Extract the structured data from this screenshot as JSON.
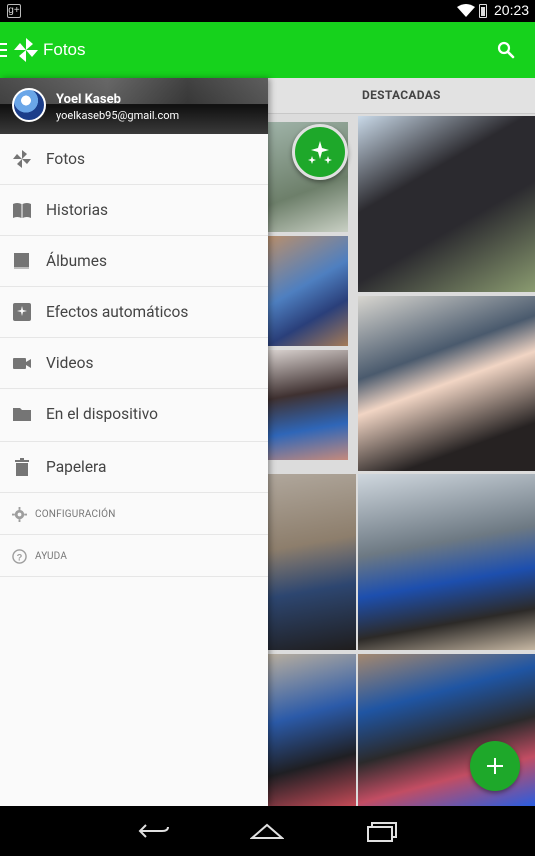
{
  "status_bar": {
    "time": "20:23",
    "notification_icon": "google-plus-icon"
  },
  "app_bar": {
    "title": "Fotos",
    "brand_color": "#16d21c"
  },
  "tabs": {
    "selected": "DESTACADAS"
  },
  "drawer": {
    "account": {
      "name": "Yoel Kaseb",
      "email": "yoelkaseb95@gmail.com"
    },
    "items": [
      {
        "label": "Fotos",
        "icon": "pinwheel-icon"
      },
      {
        "label": "Historias",
        "icon": "book-icon"
      },
      {
        "label": "Álbumes",
        "icon": "album-icon"
      },
      {
        "label": "Efectos automáticos",
        "icon": "sparkle-icon"
      },
      {
        "label": "Videos",
        "icon": "video-camera-icon"
      },
      {
        "label": "En el dispositivo",
        "icon": "folder-icon"
      },
      {
        "label": "Papelera",
        "icon": "trash-icon"
      }
    ],
    "secondary": [
      {
        "label": "CONFIGURACIÓN",
        "icon": "gear-icon"
      },
      {
        "label": "AYUDA",
        "icon": "help-icon"
      }
    ]
  },
  "fab": {
    "icon": "plus-icon",
    "color": "#1ea82a"
  }
}
